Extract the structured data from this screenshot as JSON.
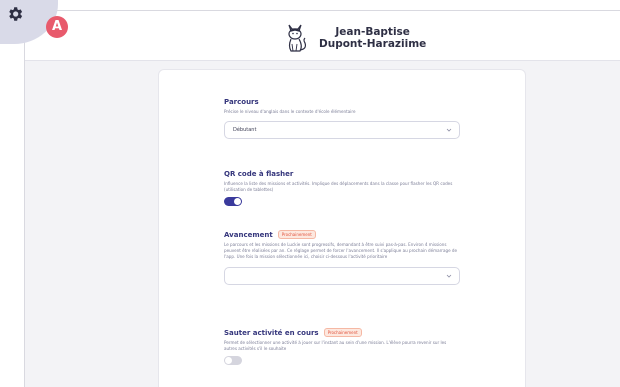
{
  "header": {
    "avatar_initial": "A",
    "brand_line1": "Jean-Baptise",
    "brand_line2": "Dupont-Haraziime"
  },
  "sections": [
    {
      "title": "Parcours",
      "description": "Précise le niveau d'anglais dans le contexte d'école élémentaire",
      "control": "select",
      "value": "Débutant"
    },
    {
      "title": "QR code à flasher",
      "description": "Influence la liste des missions et activités. Implique des déplacements dans la classe pour flasher les QR codes (utilisation de tablettes)",
      "control": "toggle",
      "toggle_on": true
    },
    {
      "title": "Avancement",
      "badge": "Prochainement",
      "description": "Le parcours et les missions de Luckie sont progressifs, demandant à être suivi pas-à-pas. Environ 4 missions peuvent être réalisées par an. Ce réglage permet de forcer l'avancement. Il s'applique au prochain démarrage de l'app. Une fois la mission sélectionnée ici, choisir ci-dessous l'activité prioritaire",
      "control": "select",
      "value": ""
    },
    {
      "title": "Sauter activité en cours",
      "badge": "Prochainement",
      "description": "Permet de sélectionner une activité à jouer sur l'instant au sein d'une mission. L'élève pourra revenir sur les autres activités s'il le souhaite",
      "control": "toggle",
      "toggle_on": false
    }
  ],
  "colors": {
    "accent": "#3a3a9c",
    "title": "#35367c",
    "badge": "#e0523c",
    "avatar": "#e85a6c",
    "background": "#f3f3f6"
  },
  "icons": {
    "settings": "gear-icon",
    "logo": "cat-logo-icon",
    "select_arrow": "chevron-down-icon"
  }
}
